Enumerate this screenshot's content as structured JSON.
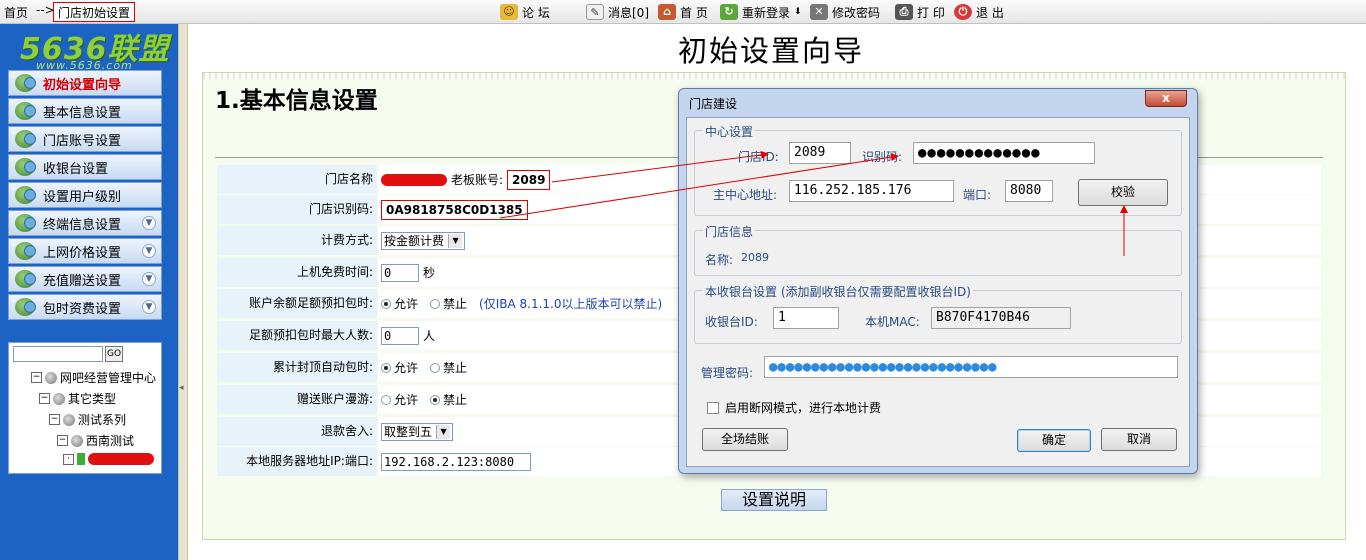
{
  "topbar": {
    "breadcrumb_home": "首页",
    "breadcrumb_arrow": "-->",
    "breadcrumb_current": "门店初始设置",
    "items": [
      {
        "label": "论 坛",
        "icon": "smiley-icon"
      },
      {
        "label": "消息[0]",
        "icon": "message-icon"
      },
      {
        "label": "首 页",
        "icon": "home-icon"
      },
      {
        "label": "重新登录",
        "icon": "relogin-icon"
      },
      {
        "label": "修改密码",
        "icon": "tools-icon"
      },
      {
        "label": "打 印",
        "icon": "printer-icon"
      },
      {
        "label": "退 出",
        "icon": "exit-icon"
      }
    ]
  },
  "sidebar": {
    "logo": "5636联盟",
    "logo_url": "www.5636.com",
    "items": [
      {
        "label": "初始设置向导",
        "active": true
      },
      {
        "label": "基本信息设置"
      },
      {
        "label": "门店账号设置"
      },
      {
        "label": "收银台设置"
      },
      {
        "label": "设置用户级别"
      },
      {
        "label": "终端信息设置",
        "expandable": true
      },
      {
        "label": "上网价格设置",
        "expandable": true
      },
      {
        "label": "充值赠送设置",
        "expandable": true
      },
      {
        "label": "包时资费设置",
        "expandable": true
      }
    ],
    "tree": {
      "search_value": "",
      "go_label": "GO",
      "nodes": [
        {
          "label": "网吧经营管理中心",
          "level": 0
        },
        {
          "label": "其它类型",
          "level": 1
        },
        {
          "label": "测试系列",
          "level": 2
        },
        {
          "label": "西南测试",
          "level": 3
        }
      ]
    }
  },
  "main": {
    "page_title": "初始设置向导",
    "section_title": "1.基本信息设置",
    "form": {
      "store_name_label": "门店名称",
      "boss_account_label": "老板账号:",
      "boss_account_value": "2089",
      "store_code_label": "门店识别码:",
      "store_code_value": "0A9818758C0D1385",
      "billing_label": "计费方式:",
      "billing_value": "按金额计费",
      "free_time_label": "上机免费时间:",
      "free_time_value": "0",
      "free_time_unit": "秒",
      "balance_label": "账户余额足额预扣包时:",
      "opt_allow": "允许",
      "opt_forbid": "禁止",
      "balance_note": "(仅IBA 8.1.1.0以上版本可以禁止)",
      "max_people_label": "足额预扣包时最大人数:",
      "max_people_value": "0",
      "max_people_unit": "人",
      "auto_cap_label": "累计封顶自动包时:",
      "gift_roam_label": "赠送账户漫游:",
      "refund_label": "退款舍入:",
      "refund_value": "取整到五",
      "server_label": "本地服务器地址IP:端口:",
      "server_value": "192.168.2.123:8080"
    },
    "help_button": "设置说明"
  },
  "dialog": {
    "title": "门店建设",
    "close": "x",
    "center_group": "中心设置",
    "store_id_label": "门店ID:",
    "store_id_value": "2089",
    "code_label": "识别码:",
    "code_value": "●●●●●●●●●●●●●",
    "main_addr_label": "主中心地址:",
    "main_addr_value": "116.252.185.176",
    "port_label": "端口:",
    "port_value": "8080",
    "verify_button": "校验",
    "store_info_group": "门店信息",
    "name_label": "名称:",
    "name_value": "2089",
    "cashier_group": "本收银台设置 (添加副收银台仅需要配置收银台ID)",
    "cashier_id_label": "收银台ID:",
    "cashier_id_value": "1",
    "mac_label": "本机MAC:",
    "mac_value": "B870F4170B46",
    "admin_pwd_label": "管理密码:",
    "admin_pwd_value": "●●●●●●●●●●●●●●●●●●●●●●●●●●●",
    "offline_label": "启用断网模式，进行本地计费",
    "settle_button": "全场结账",
    "ok_button": "确定",
    "cancel_button": "取消"
  },
  "colors": {
    "sidebar_bg": "#1d63c4",
    "highlight_red": "#e00000",
    "dialog_frame": "#c4d6ee",
    "note_blue": "#1a3fc0"
  }
}
